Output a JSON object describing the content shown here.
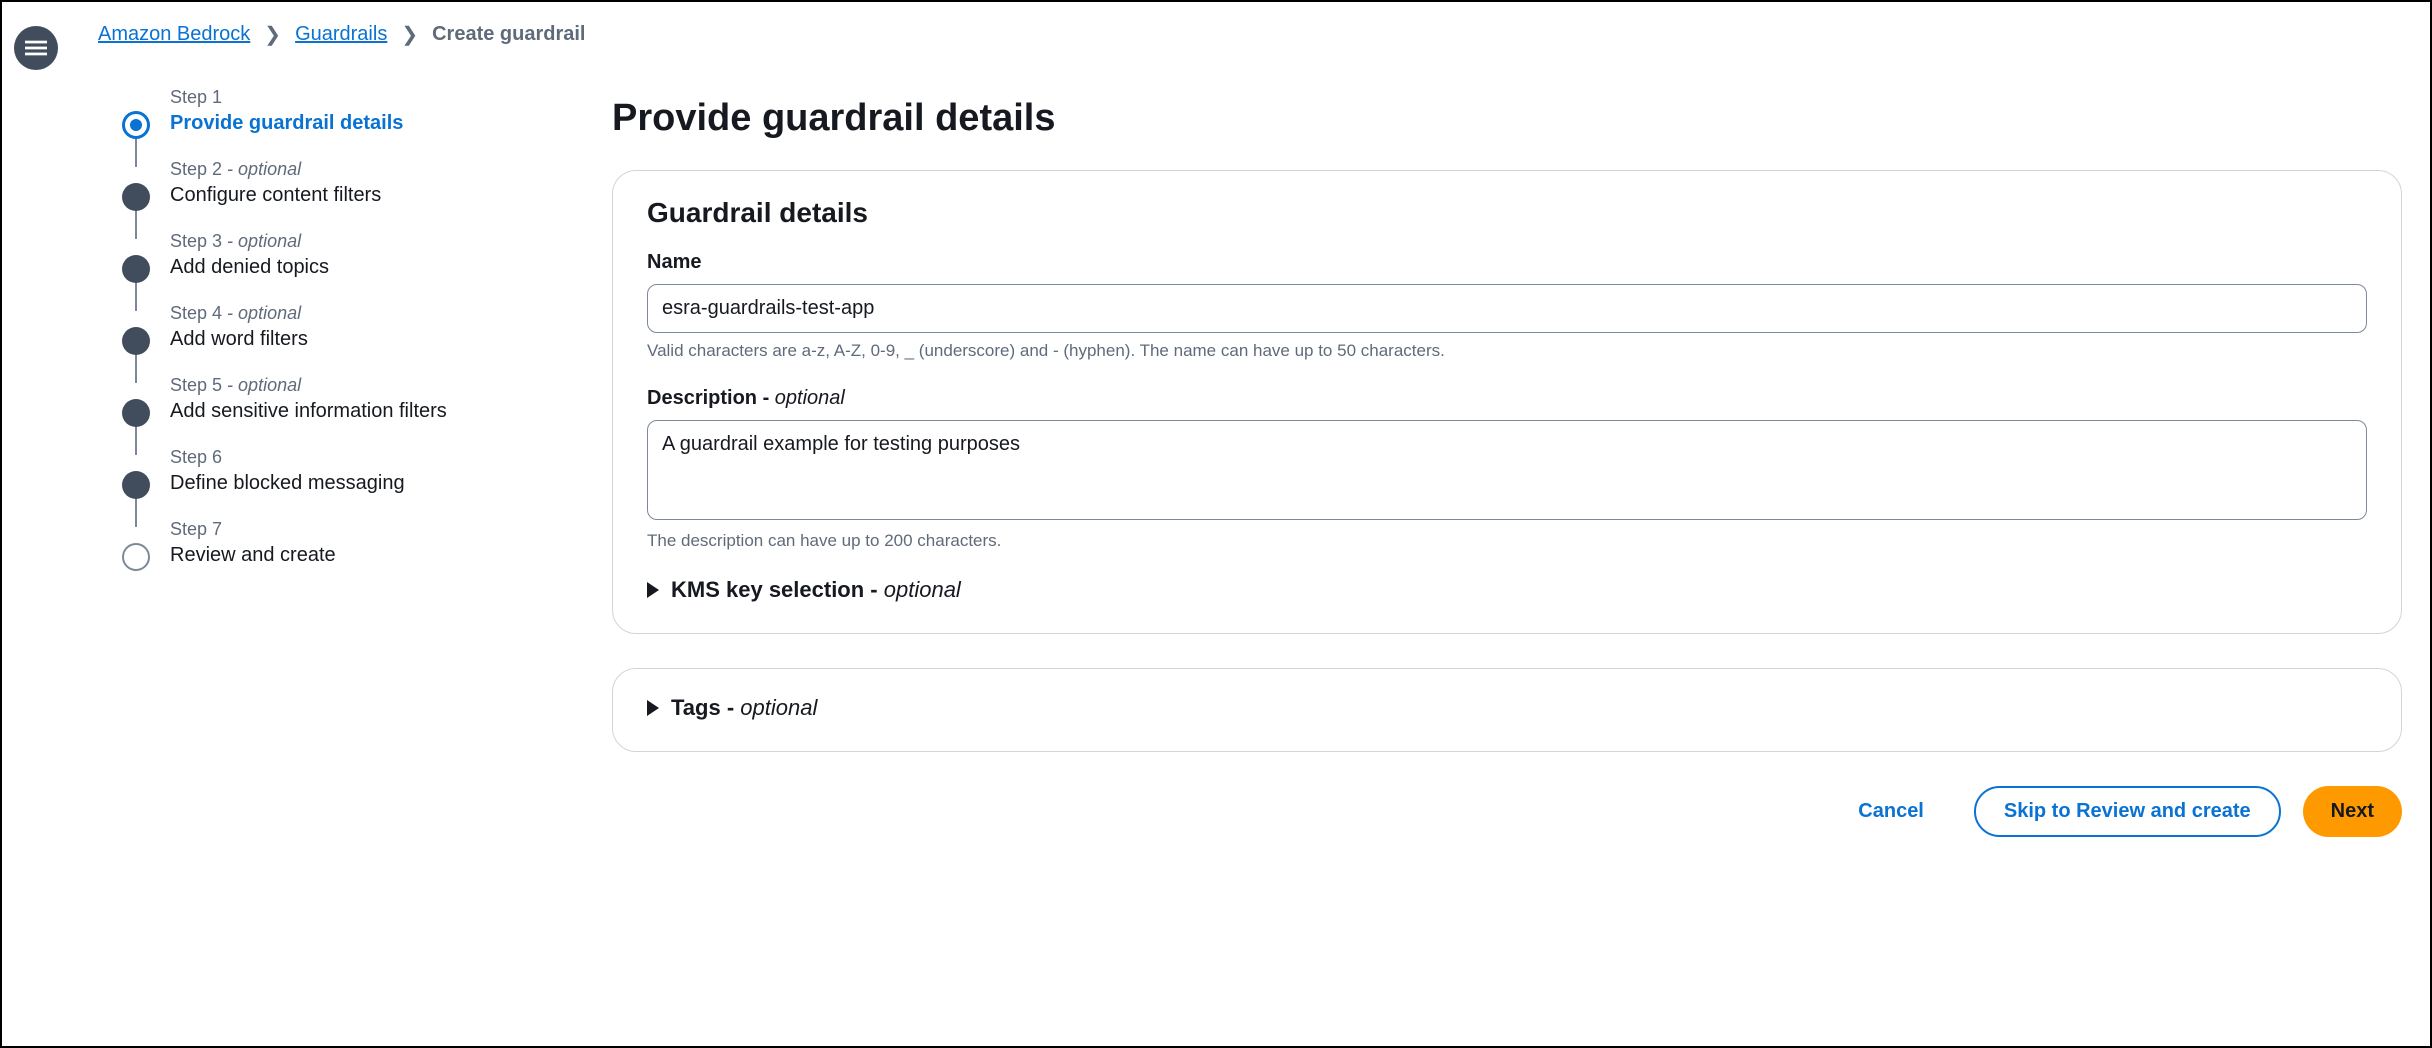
{
  "breadcrumb": {
    "items": [
      {
        "label": "Amazon Bedrock",
        "link": true
      },
      {
        "label": "Guardrails",
        "link": true
      },
      {
        "label": "Create guardrail",
        "link": false
      }
    ]
  },
  "wizard": {
    "steps": [
      {
        "step_label": "Step 1",
        "title": "Provide guardrail details",
        "optional": false,
        "state": "active"
      },
      {
        "step_label": "Step 2",
        "title": "Configure content filters",
        "optional": true,
        "state": "future"
      },
      {
        "step_label": "Step 3",
        "title": "Add denied topics",
        "optional": true,
        "state": "future"
      },
      {
        "step_label": "Step 4",
        "title": "Add word filters",
        "optional": true,
        "state": "future"
      },
      {
        "step_label": "Step 5",
        "title": "Add sensitive information filters",
        "optional": true,
        "state": "future"
      },
      {
        "step_label": "Step 6",
        "title": "Define blocked messaging",
        "optional": false,
        "state": "future"
      },
      {
        "step_label": "Step 7",
        "title": "Review and create",
        "optional": false,
        "state": "last"
      }
    ],
    "optional_suffix": " - optional"
  },
  "main": {
    "page_title": "Provide guardrail details",
    "panel_title": "Guardrail details",
    "name_label": "Name",
    "name_value": "esra-guardrails-test-app",
    "name_help": "Valid characters are a-z, A-Z, 0-9, _ (underscore) and - (hyphen). The name can have up to 50 characters.",
    "desc_label": "Description - ",
    "desc_optional": "optional",
    "desc_value": "A guardrail example for testing purposes",
    "desc_help": "The description can have up to 200 characters.",
    "kms_label": "KMS key selection - ",
    "kms_optional": "optional",
    "tags_label": "Tags - ",
    "tags_optional": "optional"
  },
  "footer": {
    "cancel": "Cancel",
    "skip": "Skip to Review and create",
    "next": "Next"
  }
}
